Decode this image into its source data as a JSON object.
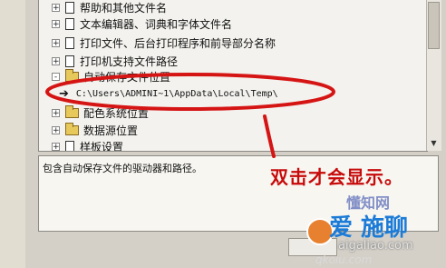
{
  "tree": {
    "items": [
      {
        "label": "帮助和其他文件名",
        "icon": "document-icon",
        "expander": "+"
      },
      {
        "label": "文本编辑器、词典和字体文件名",
        "icon": "document-icon",
        "expander": "+"
      },
      {
        "label": "打印文件、后台打印程序和前导部分名称",
        "icon": "document-icon",
        "expander": "+"
      },
      {
        "label": "打印机支持文件路径",
        "icon": "document-icon",
        "expander": "+"
      },
      {
        "label": "自动保存文件位置",
        "icon": "folder-icon",
        "expander": "-"
      },
      {
        "label": "配色系统位置",
        "icon": "folder-icon",
        "expander": "+"
      },
      {
        "label": "数据源位置",
        "icon": "folder-icon",
        "expander": "+"
      },
      {
        "label": "样板设置",
        "icon": "document-icon",
        "expander": "+"
      }
    ],
    "autosave_path": "C:\\Users\\ADMINI~1\\AppData\\Local\\Temp\\"
  },
  "description": "包含自动保存文件的驱动器和路径。",
  "annotation": "双击才会显示。",
  "watermark": {
    "site_text": "懂知网",
    "brand": "爱 施聊",
    "domain": "aigaliao.com",
    "domain2": "qkoiu.com"
  },
  "colors": {
    "annotation": "#c70a0a",
    "highlight_ellipse": "#d51414"
  }
}
